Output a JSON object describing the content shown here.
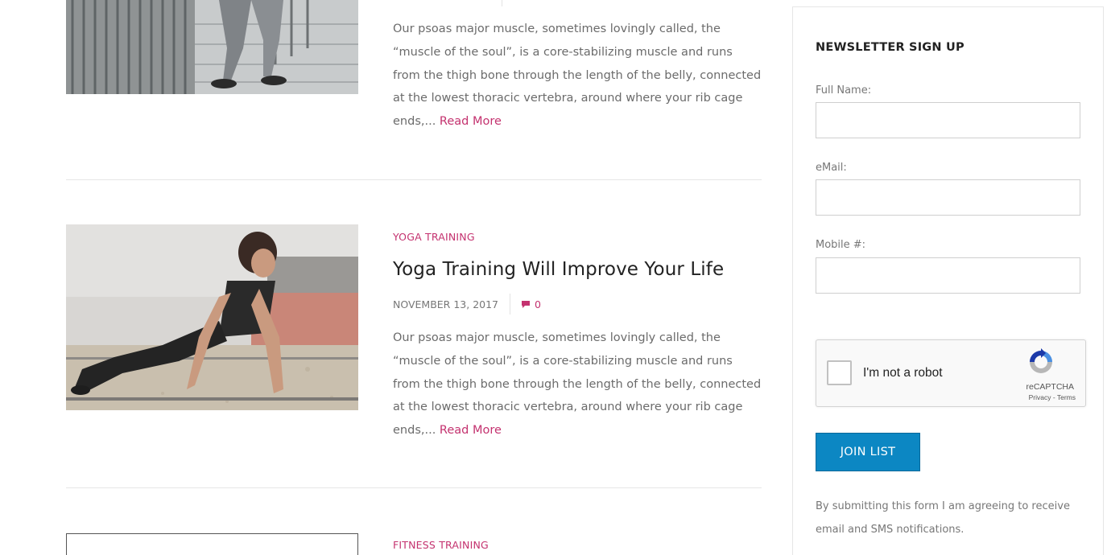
{
  "posts": [
    {
      "excerpt": "Our psoas major muscle, sometimes lovingly called, the “muscle of the soul”, is a core-stabilizing muscle and runs from the thigh bone through the length of the belly, connected at the lowest thoracic vertebra, around where your rib cage ends,...",
      "read_more": "Read More"
    },
    {
      "category": "YOGA TRAINING",
      "title": "Yoga Training Will Improve Your Life",
      "date": "NOVEMBER 13, 2017",
      "comments": "0",
      "excerpt": "Our psoas major muscle, sometimes lovingly called, the “muscle of the soul”, is a core-stabilizing muscle and runs from the thigh bone through the length of the belly, connected at the lowest thoracic vertebra, around where your rib cage ends,...",
      "read_more": "Read More"
    },
    {
      "category": "FITNESS TRAINING"
    }
  ],
  "newsletter": {
    "title": "NEWSLETTER SIGN UP",
    "full_name_label": "Full Name:",
    "email_label": "eMail:",
    "mobile_label": "Mobile #:",
    "full_name_value": "",
    "email_value": "",
    "mobile_value": "",
    "captcha": {
      "label": "I'm not a robot",
      "brand": "reCAPTCHA",
      "links": "Privacy - Terms"
    },
    "submit_label": "JOIN LIST",
    "disclaimer": "By submitting this form I am agreeing to receive email and SMS notifications."
  },
  "colors": {
    "accent": "#c4326f",
    "button": "#0c87c3",
    "title": "#222222",
    "body_text": "#6b6b6b"
  },
  "icons": {
    "comment": "comment-icon",
    "captcha": "recaptcha-logo-icon"
  }
}
